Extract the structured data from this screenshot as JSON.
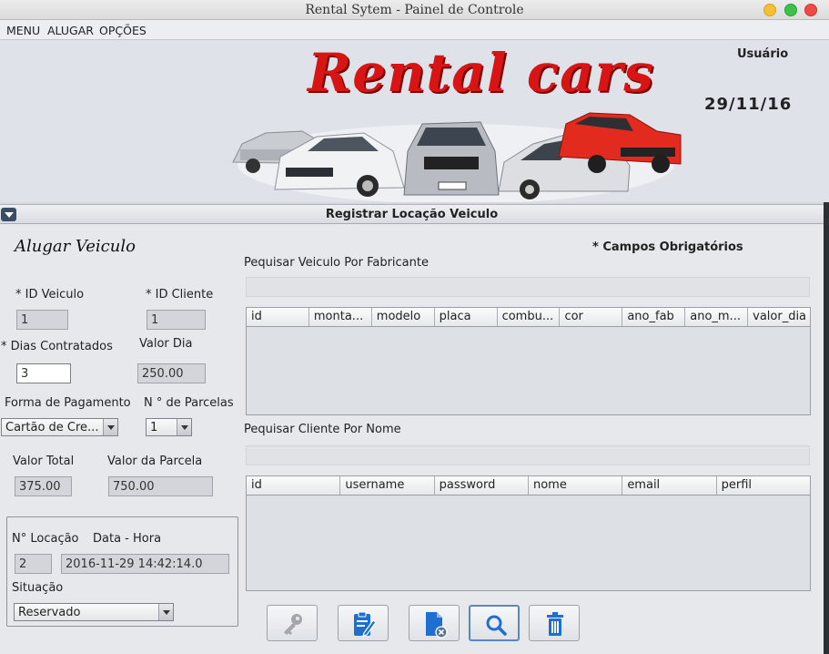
{
  "window": {
    "title": "Rental Sytem - Painel de Controle"
  },
  "menu": {
    "items": [
      "MENU",
      "ALUGAR",
      "OPÇÕES"
    ]
  },
  "header": {
    "logo": "Rental cars",
    "user": "Usuário",
    "date": "29/11/16"
  },
  "panel": {
    "title": "Registrar Locação Veiculo"
  },
  "form": {
    "heading": "Alugar Veiculo",
    "required_note": "* Campos Obrigatórios",
    "id_veiculo_label": "* ID Veiculo",
    "id_veiculo": "1",
    "id_cliente_label": "* ID Cliente",
    "id_cliente": "1",
    "dias_label": "* Dias Contratados",
    "dias": "3",
    "valor_dia_label": "Valor Dia",
    "valor_dia": "250.00",
    "pagamento_label": "Forma de Pagamento",
    "pagamento": "Cartão de Cre...",
    "parcelas_label": "N ° de Parcelas",
    "parcelas": "1",
    "valor_total_label": "Valor Total",
    "valor_total": "375.00",
    "valor_parcela_label": "Valor da Parcela",
    "valor_parcela": "750.00",
    "locacao_label": "N° Locação",
    "locacao": "2",
    "data_hora_label": "Data - Hora",
    "data_hora": "2016-11-29 14:42:14.0",
    "situacao_label": "Situação",
    "situacao": "Reservado"
  },
  "vehicle_search": {
    "label": "Pequisar Veiculo Por Fabricante",
    "columns": [
      "id",
      "monta...",
      "modelo",
      "placa",
      "combu...",
      "cor",
      "ano_fab",
      "ano_m...",
      "valor_dia"
    ]
  },
  "client_search": {
    "label": "Pequisar Cliente Por Nome",
    "columns": [
      "id",
      "username",
      "password",
      "nome",
      "email",
      "perfil"
    ]
  },
  "toolbar": {
    "buttons": [
      {
        "name": "key-button",
        "icon": "key-icon"
      },
      {
        "name": "edit-button",
        "icon": "edit-clipboard-icon"
      },
      {
        "name": "cancel-document-button",
        "icon": "document-cancel-icon"
      },
      {
        "name": "search-button",
        "icon": "search-icon"
      },
      {
        "name": "delete-button",
        "icon": "trash-icon"
      }
    ]
  },
  "colors": {
    "logo": "#d81414",
    "accent": "#1e6fd0",
    "panel_bg": "#e6e8ec"
  }
}
